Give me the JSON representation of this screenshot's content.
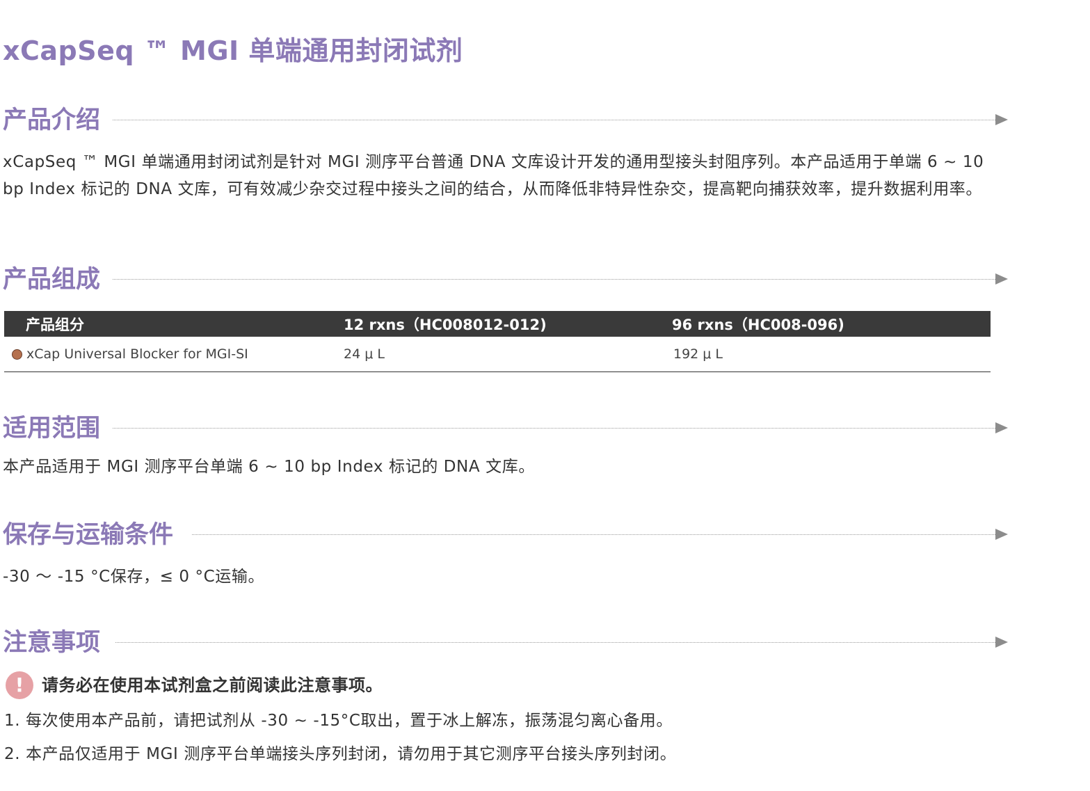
{
  "title": "xCapSeq ™  MGI 单端通用封闭试剂",
  "sections": {
    "intro": {
      "heading": "产品介绍",
      "text": "xCapSeq ™ MGI 单端通用封闭试剂是针对 MGI 测序平台普通 DNA 文库设计开发的通用型接头封阻序列。本产品适用于单端 6 ~ 10 bp Index 标记的 DNA 文库，可有效减少杂交过程中接头之间的结合，从而降低非特异性杂交，提高靶向捕获效率，提升数据利用率。"
    },
    "composition": {
      "heading": "产品组成",
      "table": {
        "headers": [
          "产品组分",
          "12  rxns（HC008012-012)",
          "96  rxns（HC008-096)"
        ],
        "rows": [
          {
            "component": "xCap Universal Blocker for MGI-SI",
            "rxn12": "24 μ L",
            "rxn96": "192 μ L",
            "dot_color": "#b5714f"
          }
        ]
      }
    },
    "scope": {
      "heading": "适用范围",
      "text": "本产品适用于 MGI 测序平台单端 6 ~ 10 bp Index 标记的 DNA 文库。"
    },
    "storage": {
      "heading": "保存与运输条件",
      "text": "-30 ～ -15 °C保存，≤ 0 °C运输。"
    },
    "notes": {
      "heading": "注意事项",
      "warning_icon": "exclamation-icon",
      "warning": "请务必在使用本试剂盒之前阅读此注意事项。",
      "items": [
        "1. 每次使用本产品前，请把试剂从 -30 ~ -15°C取出，置于冰上解冻，振荡混匀离心备用。",
        "2. 本产品仅适用于 MGI 测序平台单端接头序列封闭，请勿用于其它测序平台接头序列封闭。"
      ]
    }
  },
  "colors": {
    "heading": "#8b79b6",
    "table_header_bg": "#3a3a3a",
    "warning_icon_bg": "#e6a1a5"
  }
}
